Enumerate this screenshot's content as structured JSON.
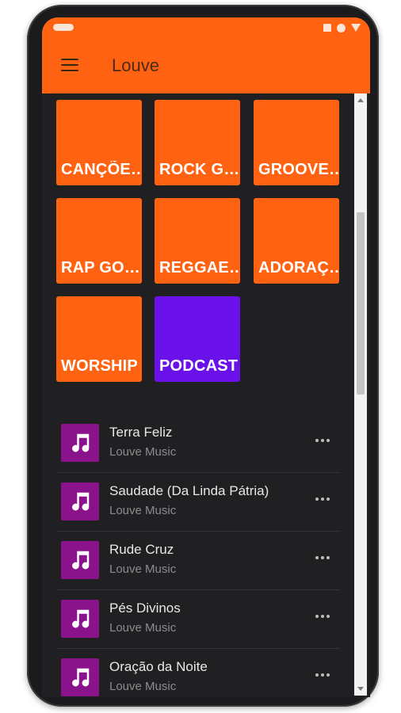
{
  "appbar": {
    "title": "Louve",
    "menu_icon": "hamburger-menu-icon"
  },
  "status_bar": {
    "icons": [
      "square-icon",
      "circle-icon",
      "triangle-icon"
    ]
  },
  "categories": [
    {
      "label": "CANÇÕE…",
      "color": "#ff6312"
    },
    {
      "label": "ROCK G…",
      "color": "#ff6312"
    },
    {
      "label": "GROOVE…",
      "color": "#ff6312"
    },
    {
      "label": "RAP GO…",
      "color": "#ff6312"
    },
    {
      "label": "REGGAE…",
      "color": "#ff6312"
    },
    {
      "label": "ADORAÇ…",
      "color": "#ff6312"
    },
    {
      "label": "WORSHIP",
      "color": "#ff6312"
    },
    {
      "label": "PODCAST",
      "color": "#6a11e9"
    }
  ],
  "tracks": [
    {
      "title": "Terra Feliz",
      "artist": "Louve Music"
    },
    {
      "title": "Saudade (Da Linda Pátria)",
      "artist": "Louve Music"
    },
    {
      "title": "Rude Cruz",
      "artist": "Louve Music"
    },
    {
      "title": "Pés Divinos",
      "artist": "Louve Music"
    },
    {
      "title": "Oração da Noite",
      "artist": "Louve Music"
    }
  ],
  "colors": {
    "accent": "#ff6312",
    "podcast": "#6a11e9",
    "track_art": "#8a138c",
    "background": "#202022"
  }
}
